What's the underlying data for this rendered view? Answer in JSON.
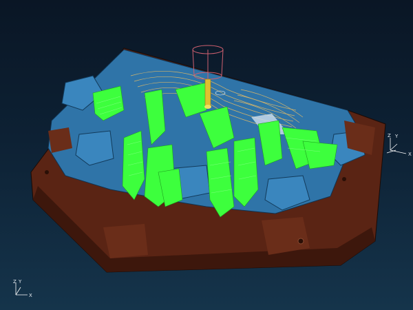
{
  "viewport": {
    "background_top": "#0a1625",
    "background_bottom": "#15344b"
  },
  "model": {
    "base_color": "#5a2414",
    "top_color": "#2f74a8",
    "toolpath_color": "#3dff3d",
    "slice_color": "#f0c060",
    "cutter_color": "#d06070"
  },
  "triad_model": {
    "z_label": "Z",
    "y_label": "Y",
    "x_label": "X"
  },
  "triad_world": {
    "z_label": "Z",
    "y_label": "Y",
    "x_label": "X"
  }
}
